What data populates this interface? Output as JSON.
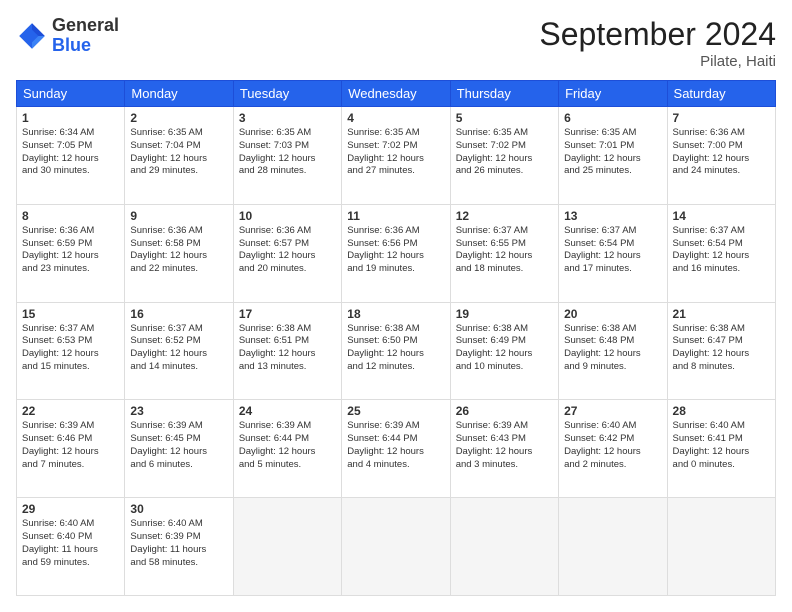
{
  "header": {
    "logo_general": "General",
    "logo_blue": "Blue",
    "month_title": "September 2024",
    "subtitle": "Pilate, Haiti"
  },
  "weekdays": [
    "Sunday",
    "Monday",
    "Tuesday",
    "Wednesday",
    "Thursday",
    "Friday",
    "Saturday"
  ],
  "weeks": [
    [
      {
        "day": "1",
        "info": "Sunrise: 6:34 AM\nSunset: 7:05 PM\nDaylight: 12 hours\nand 30 minutes."
      },
      {
        "day": "2",
        "info": "Sunrise: 6:35 AM\nSunset: 7:04 PM\nDaylight: 12 hours\nand 29 minutes."
      },
      {
        "day": "3",
        "info": "Sunrise: 6:35 AM\nSunset: 7:03 PM\nDaylight: 12 hours\nand 28 minutes."
      },
      {
        "day": "4",
        "info": "Sunrise: 6:35 AM\nSunset: 7:02 PM\nDaylight: 12 hours\nand 27 minutes."
      },
      {
        "day": "5",
        "info": "Sunrise: 6:35 AM\nSunset: 7:02 PM\nDaylight: 12 hours\nand 26 minutes."
      },
      {
        "day": "6",
        "info": "Sunrise: 6:35 AM\nSunset: 7:01 PM\nDaylight: 12 hours\nand 25 minutes."
      },
      {
        "day": "7",
        "info": "Sunrise: 6:36 AM\nSunset: 7:00 PM\nDaylight: 12 hours\nand 24 minutes."
      }
    ],
    [
      {
        "day": "8",
        "info": "Sunrise: 6:36 AM\nSunset: 6:59 PM\nDaylight: 12 hours\nand 23 minutes."
      },
      {
        "day": "9",
        "info": "Sunrise: 6:36 AM\nSunset: 6:58 PM\nDaylight: 12 hours\nand 22 minutes."
      },
      {
        "day": "10",
        "info": "Sunrise: 6:36 AM\nSunset: 6:57 PM\nDaylight: 12 hours\nand 20 minutes."
      },
      {
        "day": "11",
        "info": "Sunrise: 6:36 AM\nSunset: 6:56 PM\nDaylight: 12 hours\nand 19 minutes."
      },
      {
        "day": "12",
        "info": "Sunrise: 6:37 AM\nSunset: 6:55 PM\nDaylight: 12 hours\nand 18 minutes."
      },
      {
        "day": "13",
        "info": "Sunrise: 6:37 AM\nSunset: 6:54 PM\nDaylight: 12 hours\nand 17 minutes."
      },
      {
        "day": "14",
        "info": "Sunrise: 6:37 AM\nSunset: 6:54 PM\nDaylight: 12 hours\nand 16 minutes."
      }
    ],
    [
      {
        "day": "15",
        "info": "Sunrise: 6:37 AM\nSunset: 6:53 PM\nDaylight: 12 hours\nand 15 minutes."
      },
      {
        "day": "16",
        "info": "Sunrise: 6:37 AM\nSunset: 6:52 PM\nDaylight: 12 hours\nand 14 minutes."
      },
      {
        "day": "17",
        "info": "Sunrise: 6:38 AM\nSunset: 6:51 PM\nDaylight: 12 hours\nand 13 minutes."
      },
      {
        "day": "18",
        "info": "Sunrise: 6:38 AM\nSunset: 6:50 PM\nDaylight: 12 hours\nand 12 minutes."
      },
      {
        "day": "19",
        "info": "Sunrise: 6:38 AM\nSunset: 6:49 PM\nDaylight: 12 hours\nand 10 minutes."
      },
      {
        "day": "20",
        "info": "Sunrise: 6:38 AM\nSunset: 6:48 PM\nDaylight: 12 hours\nand 9 minutes."
      },
      {
        "day": "21",
        "info": "Sunrise: 6:38 AM\nSunset: 6:47 PM\nDaylight: 12 hours\nand 8 minutes."
      }
    ],
    [
      {
        "day": "22",
        "info": "Sunrise: 6:39 AM\nSunset: 6:46 PM\nDaylight: 12 hours\nand 7 minutes."
      },
      {
        "day": "23",
        "info": "Sunrise: 6:39 AM\nSunset: 6:45 PM\nDaylight: 12 hours\nand 6 minutes."
      },
      {
        "day": "24",
        "info": "Sunrise: 6:39 AM\nSunset: 6:44 PM\nDaylight: 12 hours\nand 5 minutes."
      },
      {
        "day": "25",
        "info": "Sunrise: 6:39 AM\nSunset: 6:44 PM\nDaylight: 12 hours\nand 4 minutes."
      },
      {
        "day": "26",
        "info": "Sunrise: 6:39 AM\nSunset: 6:43 PM\nDaylight: 12 hours\nand 3 minutes."
      },
      {
        "day": "27",
        "info": "Sunrise: 6:40 AM\nSunset: 6:42 PM\nDaylight: 12 hours\nand 2 minutes."
      },
      {
        "day": "28",
        "info": "Sunrise: 6:40 AM\nSunset: 6:41 PM\nDaylight: 12 hours\nand 0 minutes."
      }
    ],
    [
      {
        "day": "29",
        "info": "Sunrise: 6:40 AM\nSunset: 6:40 PM\nDaylight: 11 hours\nand 59 minutes."
      },
      {
        "day": "30",
        "info": "Sunrise: 6:40 AM\nSunset: 6:39 PM\nDaylight: 11 hours\nand 58 minutes."
      },
      {
        "day": "",
        "info": ""
      },
      {
        "day": "",
        "info": ""
      },
      {
        "day": "",
        "info": ""
      },
      {
        "day": "",
        "info": ""
      },
      {
        "day": "",
        "info": ""
      }
    ]
  ]
}
